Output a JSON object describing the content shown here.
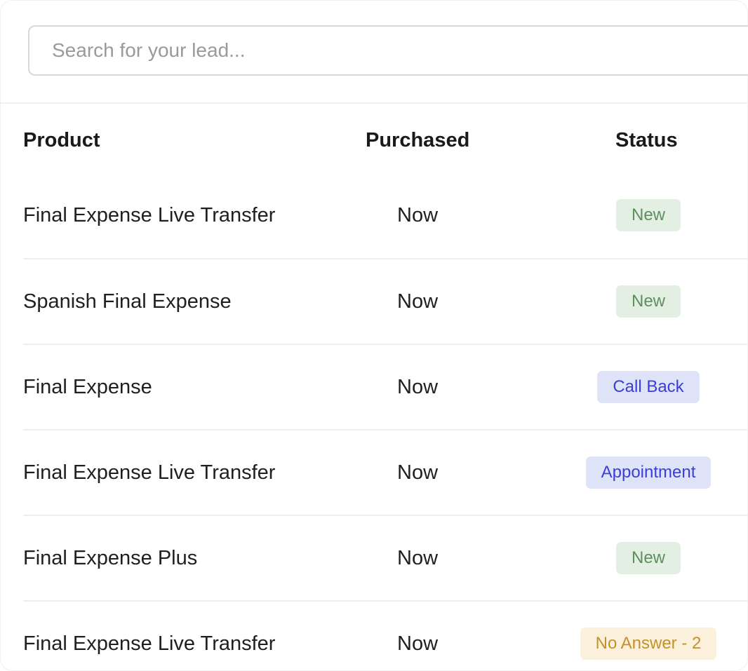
{
  "search": {
    "placeholder": "Search for your lead..."
  },
  "table": {
    "headers": {
      "product": "Product",
      "purchased": "Purchased",
      "status": "Status"
    },
    "rows": [
      {
        "product": "Final Expense Live Transfer",
        "purchased": "Now",
        "status": "New",
        "status_type": "new"
      },
      {
        "product": "Spanish Final Expense",
        "purchased": "Now",
        "status": "New",
        "status_type": "new"
      },
      {
        "product": "Final Expense",
        "purchased": "Now",
        "status": "Call Back",
        "status_type": "callback"
      },
      {
        "product": "Final Expense Live Transfer",
        "purchased": "Now",
        "status": "Appointment",
        "status_type": "appointment"
      },
      {
        "product": "Final Expense Plus",
        "purchased": "Now",
        "status": "New",
        "status_type": "new"
      },
      {
        "product": "Final Expense Live Transfer",
        "purchased": "Now",
        "status": "No Answer - 2",
        "status_type": "noanswer"
      }
    ]
  },
  "colors": {
    "new_bg": "#e3efe3",
    "new_text": "#5e8f5e",
    "callback_bg": "#dfe3f7",
    "callback_text": "#3b3ed8",
    "noanswer_bg": "#fbf0dc",
    "noanswer_text": "#c4922a"
  }
}
